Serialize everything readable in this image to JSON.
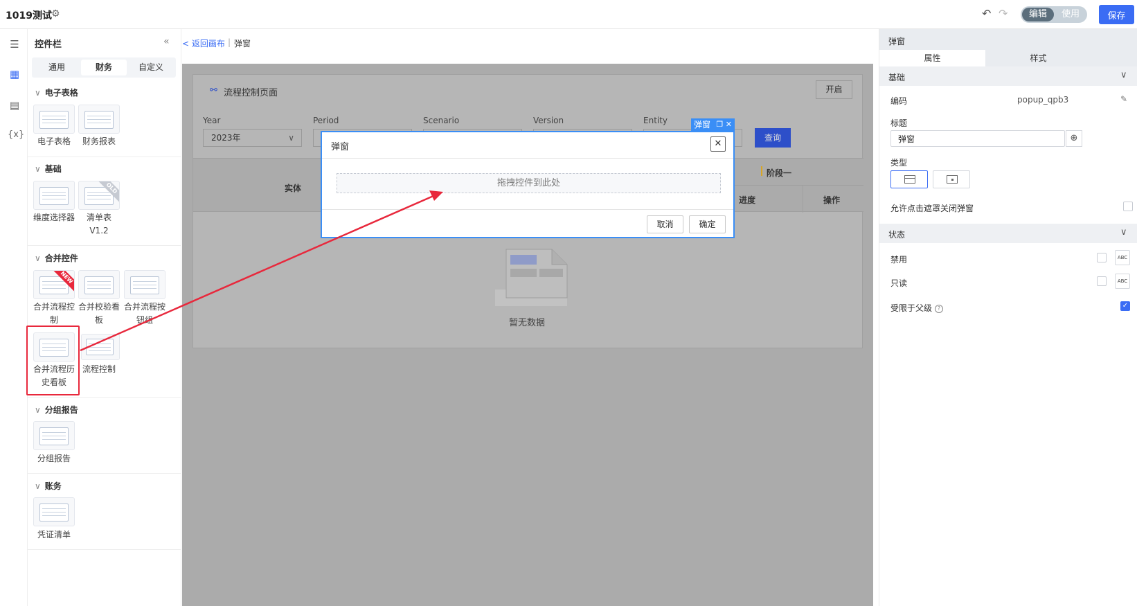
{
  "app": {
    "title": "1019测试",
    "mode_edit": "编辑",
    "mode_use": "使用",
    "save": "保存"
  },
  "panel": {
    "title": "控件栏",
    "tabs": [
      "通用",
      "财务",
      "自定义"
    ],
    "active_tab": "财务",
    "sections": [
      {
        "title": "电子表格",
        "items": [
          "电子表格",
          "财务报表"
        ]
      },
      {
        "title": "基础",
        "items": [
          "维度选择器",
          "清单表",
          "V1.2"
        ],
        "badge": "OLD"
      },
      {
        "title": "合并控件",
        "items": [
          "合并流程控",
          "制",
          "合并校验看",
          "板",
          "合并流程按",
          "钮组",
          "合并流程历",
          "史看板",
          "流程控制"
        ],
        "badge": "NEW"
      },
      {
        "title": "分组报告",
        "items": [
          "分组报告"
        ]
      },
      {
        "title": "账务",
        "items": [
          "凭证清单"
        ]
      }
    ]
  },
  "breadcrumb": {
    "back": "< 返回画布",
    "sep": "|",
    "current": "弹窗"
  },
  "canvas": {
    "card_title": "流程控制页面",
    "open_button": "开启",
    "filters": [
      {
        "label": "Year",
        "value": "2023年"
      },
      {
        "label": "Period",
        "value": ""
      },
      {
        "label": "Scenario",
        "value": ""
      },
      {
        "label": "Version",
        "value": ""
      },
      {
        "label": "Entity",
        "value": ""
      }
    ],
    "query_button": "查询",
    "table": {
      "entity": "实体",
      "stage": "阶段一",
      "progress": "进度",
      "ops": "操作"
    },
    "empty_text": "暂无数据"
  },
  "dialog": {
    "tag": "弹窗",
    "title": "弹窗",
    "drop_hint": "拖拽控件到此处",
    "cancel": "取消",
    "confirm": "确定"
  },
  "props": {
    "header": "弹窗",
    "tabs": [
      "属性",
      "样式"
    ],
    "group_basic": "基础",
    "code_label": "编码",
    "code_value": "popup_qpb3",
    "title_label": "标题",
    "title_value": "弹窗",
    "type_label": "类型",
    "mask_close_label": "允许点击遮罩关闭弹窗",
    "group_state": "状态",
    "disabled_label": "禁用",
    "readonly_label": "只读",
    "limited_label": "受限于父级",
    "abc": "ABC"
  },
  "colors": {
    "accent": "#3a6cf4",
    "dialog_border": "#3a8ef6",
    "highlight": "#e8283c"
  }
}
